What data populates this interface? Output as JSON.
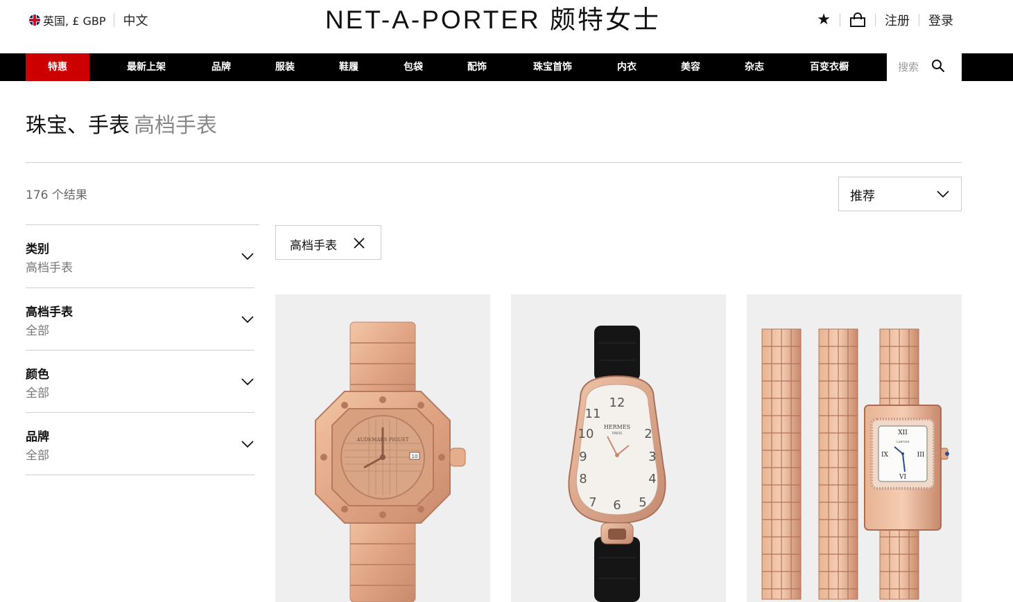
{
  "header": {
    "locale_label": "英国, £ GBP",
    "language_label": "中文",
    "logo_text": "NET-A-PORTER 颇特女士",
    "register_label": "注册",
    "login_label": "登录",
    "wishlist_icon": "star-icon",
    "bag_icon": "shopping-bag-icon"
  },
  "nav": {
    "items": [
      "特惠",
      "最新上架",
      "品牌",
      "服装",
      "鞋履",
      "包袋",
      "配饰",
      "珠宝首饰",
      "内衣",
      "美容",
      "杂志",
      "百变衣橱"
    ],
    "search_placeholder": "搜索",
    "sale_color": "#cc0000"
  },
  "page": {
    "title": "珠宝、手表",
    "subtitle": "高档手表",
    "results_count": "176 个结果",
    "sort_label": "推荐"
  },
  "filters": [
    {
      "title": "类别",
      "value": "高档手表"
    },
    {
      "title": "高档手表",
      "value": "全部"
    },
    {
      "title": "颜色",
      "value": "全部"
    },
    {
      "title": "品牌",
      "value": "全部"
    }
  ],
  "active_filters": [
    {
      "label": "高档手表"
    }
  ],
  "products": [
    {
      "dial_brand": "AUDEMARS PIGUET",
      "dial_date": "10"
    },
    {
      "dial_brand": "HERMES",
      "dial_city": "PARIS",
      "numerals": [
        "12",
        "11",
        "10",
        "9",
        "8",
        "7",
        "6",
        "5",
        "4",
        "3",
        "2"
      ]
    },
    {
      "dial_brand": "CARTIER",
      "numerals": [
        "XII",
        "III",
        "VI",
        "IX"
      ]
    }
  ]
}
